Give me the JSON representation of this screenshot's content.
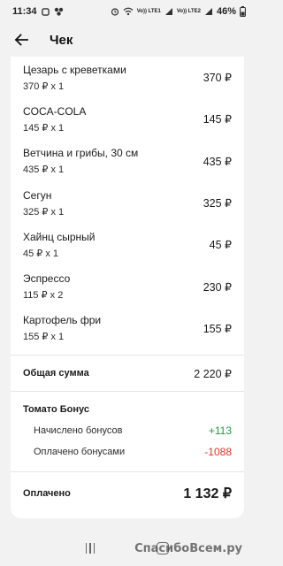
{
  "status_bar": {
    "time": "11:34",
    "battery": "46%",
    "sim1_label": "Vo)) LTE1",
    "sim2_label": "Vo)) LTE2"
  },
  "header": {
    "title": "Чек"
  },
  "items": [
    {
      "name": "Цезарь с креветками",
      "qty": "370 ₽ x 1",
      "price": "370 ₽"
    },
    {
      "name": "COCA-COLA",
      "qty": "145 ₽ x 1",
      "price": "145 ₽"
    },
    {
      "name": "Ветчина и грибы, 30 см",
      "qty": "435 ₽ x 1",
      "price": "435 ₽"
    },
    {
      "name": "Сегун",
      "qty": "325 ₽ x 1",
      "price": "325 ₽"
    },
    {
      "name": "Хайнц сырный",
      "qty": "45 ₽ x 1",
      "price": "45 ₽"
    },
    {
      "name": "Эспрессо",
      "qty": "115 ₽ x 2",
      "price": "230 ₽"
    },
    {
      "name": "Картофель фри",
      "qty": "155 ₽ x 1",
      "price": "155 ₽"
    }
  ],
  "total": {
    "label": "Общая сумма",
    "value": "2 220 ₽"
  },
  "bonus": {
    "title": "Томато Бонус",
    "accrued_label": "Начислено бонусов",
    "accrued_value": "+113",
    "paid_label": "Оплачено бонусами",
    "paid_value": "-1088"
  },
  "paid": {
    "label": "Оплачено",
    "value": "1 132 ₽"
  },
  "watermark": "СпасибоВсем.ру",
  "colors": {
    "background": "#f2f2f2",
    "card": "#ffffff",
    "bonus_plus": "#1f9a3a",
    "bonus_minus": "#e0342a"
  }
}
